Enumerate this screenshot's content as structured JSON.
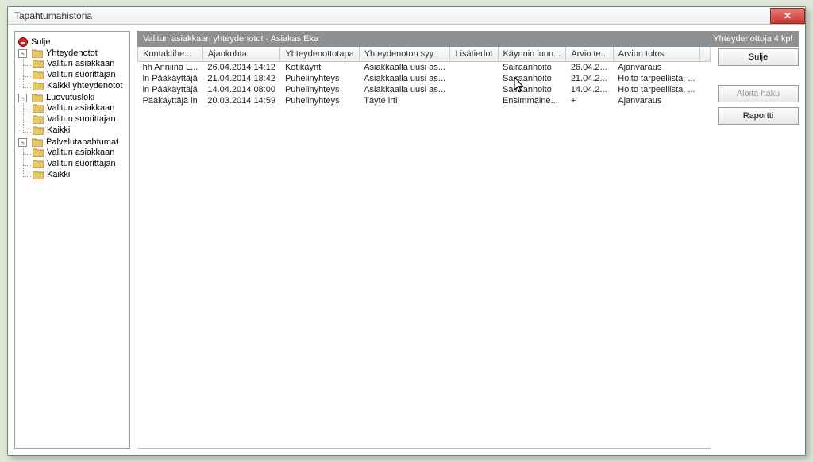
{
  "window": {
    "title": "Tapahtumahistoria"
  },
  "tree": {
    "sulje": "Sulje",
    "yhteydenotot": "Yhteydenotot",
    "valitun_asiakkaan": "Valitun asiakkaan",
    "valitun_suorittajan": "Valitun suorittajan",
    "kaikki_yhteydenotot": "Kaikki yhteydenotot",
    "luovutusloki": "Luovutusloki",
    "kaikki": "Kaikki",
    "palvelutapahtumat": "Palvelutapahtumat"
  },
  "banner": {
    "left": "Valitun asiakkaan yhteydenotot  -  Asiakas Eka",
    "right": "Yhteydenottoja 4 kpl"
  },
  "columns": {
    "c0": "Kontaktihe...",
    "c1": "Ajankohta",
    "c2": "Yhteydenottotapa",
    "c3": "Yhteydenoton syy",
    "c4": "Lisätiedot",
    "c5": "Käynnin luon...",
    "c6": "Arvio te...",
    "c7": "Arvion tulos"
  },
  "rows": [
    {
      "c0": "hh Anniina L...",
      "c1": "26.04.2014 14:12",
      "c2": "Kotikäynti",
      "c3": "Asiakkaalla uusi as...",
      "c4": "",
      "c5": "Sairaanhoito",
      "c6": "26.04.2...",
      "c7": "Ajanvaraus"
    },
    {
      "c0": "ln Pääkäyttäjä",
      "c1": "21.04.2014 18:42",
      "c2": "Puhelinyhteys",
      "c3": "Asiakkaalla uusi as...",
      "c4": "",
      "c5": "Sairaanhoito",
      "c6": "21.04.2...",
      "c7": "Hoito tarpeellista, ..."
    },
    {
      "c0": "ln Pääkäyttäjä",
      "c1": "14.04.2014 08:00",
      "c2": "Puhelinyhteys",
      "c3": "Asiakkaalla uusi as...",
      "c4": "",
      "c5": "Sairaanhoito",
      "c6": "14.04.2...",
      "c7": "Hoito tarpeellista, ..."
    },
    {
      "c0": "Pääkäyttäjä ln",
      "c1": "20.03.2014 14:59",
      "c2": "Puhelinyhteys",
      "c3": "Täyte irti",
      "c4": "",
      "c5": "Ensimmäine...",
      "c6": "+",
      "c7": "Ajanvaraus"
    }
  ],
  "buttons": {
    "sulje": "Sulje",
    "aloita_haku": "Aloita haku",
    "raportti": "Raportti"
  }
}
